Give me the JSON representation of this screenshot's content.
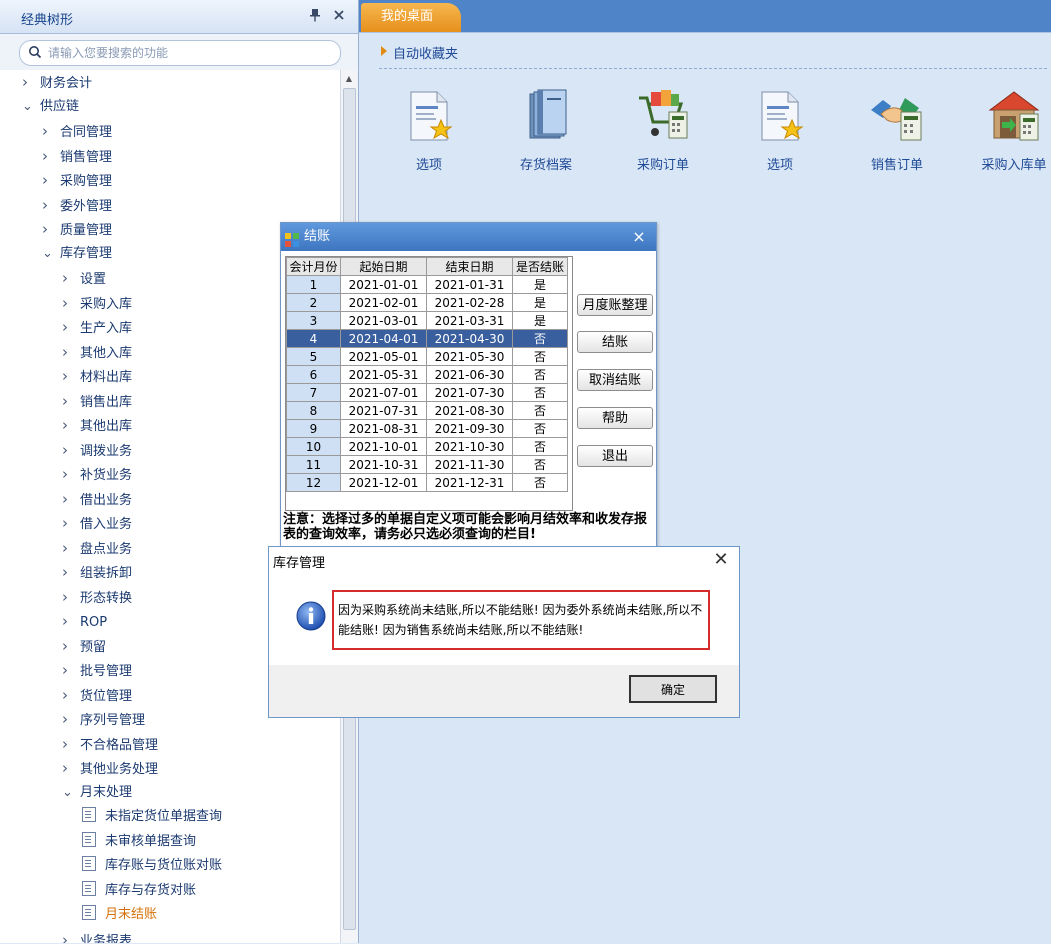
{
  "sidebar": {
    "title": "经典树形",
    "search_placeholder": "请输入您要搜索的功能",
    "tree": [
      {
        "label": "财务会计",
        "level": 0,
        "state": "collapsed"
      },
      {
        "label": "供应链",
        "level": 0,
        "state": "expanded"
      },
      {
        "label": "合同管理",
        "level": 1,
        "state": "collapsed"
      },
      {
        "label": "销售管理",
        "level": 1,
        "state": "collapsed"
      },
      {
        "label": "采购管理",
        "level": 1,
        "state": "collapsed"
      },
      {
        "label": "委外管理",
        "level": 1,
        "state": "collapsed"
      },
      {
        "label": "质量管理",
        "level": 1,
        "state": "collapsed"
      },
      {
        "label": "库存管理",
        "level": 1,
        "state": "expanded"
      },
      {
        "label": "设置",
        "level": 2,
        "state": "collapsed"
      },
      {
        "label": "采购入库",
        "level": 2,
        "state": "collapsed"
      },
      {
        "label": "生产入库",
        "level": 2,
        "state": "collapsed"
      },
      {
        "label": "其他入库",
        "level": 2,
        "state": "collapsed"
      },
      {
        "label": "材料出库",
        "level": 2,
        "state": "collapsed"
      },
      {
        "label": "销售出库",
        "level": 2,
        "state": "collapsed"
      },
      {
        "label": "其他出库",
        "level": 2,
        "state": "collapsed"
      },
      {
        "label": "调拨业务",
        "level": 2,
        "state": "collapsed"
      },
      {
        "label": "补货业务",
        "level": 2,
        "state": "collapsed"
      },
      {
        "label": "借出业务",
        "level": 2,
        "state": "collapsed"
      },
      {
        "label": "借入业务",
        "level": 2,
        "state": "collapsed"
      },
      {
        "label": "盘点业务",
        "level": 2,
        "state": "collapsed"
      },
      {
        "label": "组装拆卸",
        "level": 2,
        "state": "collapsed"
      },
      {
        "label": "形态转换",
        "level": 2,
        "state": "collapsed"
      },
      {
        "label": "ROP",
        "level": 2,
        "state": "collapsed"
      },
      {
        "label": "预留",
        "level": 2,
        "state": "collapsed"
      },
      {
        "label": "批号管理",
        "level": 2,
        "state": "collapsed"
      },
      {
        "label": "货位管理",
        "level": 2,
        "state": "collapsed"
      },
      {
        "label": "序列号管理",
        "level": 2,
        "state": "collapsed"
      },
      {
        "label": "不合格品管理",
        "level": 2,
        "state": "collapsed"
      },
      {
        "label": "其他业务处理",
        "level": 2,
        "state": "collapsed"
      },
      {
        "label": "月末处理",
        "level": 2,
        "state": "expanded"
      },
      {
        "label": "未指定货位单据查询",
        "level": 3,
        "state": "leaf"
      },
      {
        "label": "未审核单据查询",
        "level": 3,
        "state": "leaf"
      },
      {
        "label": "库存账与货位账对账",
        "level": 3,
        "state": "leaf"
      },
      {
        "label": "库存与存货对账",
        "level": 3,
        "state": "leaf"
      },
      {
        "label": "月末结账",
        "level": 3,
        "state": "leaf",
        "active": true
      },
      {
        "label": "业务报表",
        "level": 2,
        "state": "collapsed"
      }
    ]
  },
  "main": {
    "tab_label": "我的桌面",
    "favorites_title": "自动收藏夹",
    "apps": [
      {
        "label": "选项",
        "icon": "options-icon"
      },
      {
        "label": "存货档案",
        "icon": "inventory-file-icon"
      },
      {
        "label": "采购订单",
        "icon": "purchase-order-icon"
      },
      {
        "label": "选项",
        "icon": "options-icon"
      },
      {
        "label": "销售订单",
        "icon": "sales-order-icon"
      },
      {
        "label": "采购入库单",
        "icon": "purchase-receipt-icon"
      }
    ]
  },
  "close_dialog": {
    "title": "结账",
    "columns": [
      "会计月份",
      "起始日期",
      "结束日期",
      "是否结账"
    ],
    "rows": [
      [
        "1",
        "2021-01-01",
        "2021-01-31",
        "是"
      ],
      [
        "2",
        "2021-02-01",
        "2021-02-28",
        "是"
      ],
      [
        "3",
        "2021-03-01",
        "2021-03-31",
        "是"
      ],
      [
        "4",
        "2021-04-01",
        "2021-04-30",
        "否"
      ],
      [
        "5",
        "2021-05-01",
        "2021-05-30",
        "否"
      ],
      [
        "6",
        "2021-05-31",
        "2021-06-30",
        "否"
      ],
      [
        "7",
        "2021-07-01",
        "2021-07-30",
        "否"
      ],
      [
        "8",
        "2021-07-31",
        "2021-08-30",
        "否"
      ],
      [
        "9",
        "2021-08-31",
        "2021-09-30",
        "否"
      ],
      [
        "10",
        "2021-10-01",
        "2021-10-30",
        "否"
      ],
      [
        "11",
        "2021-10-31",
        "2021-11-30",
        "否"
      ],
      [
        "12",
        "2021-12-01",
        "2021-12-31",
        "否"
      ]
    ],
    "selected_row": 3,
    "buttons": {
      "reorganize": "月度账整理",
      "close": "结账",
      "cancel_close": "取消结账",
      "help": "帮助",
      "exit": "退出"
    },
    "note": "注意：选择过多的单据自定义项可能会影响月结效率和收发存报表的查询效率，请务必只选必须查询的栏目!"
  },
  "message_box": {
    "title": "库存管理",
    "message": "因为采购系统尚未结账,所以不能结账! 因为委外系统尚未结账,所以不能结账! 因为销售系统尚未结账,所以不能结账!",
    "ok_label": "确定"
  }
}
